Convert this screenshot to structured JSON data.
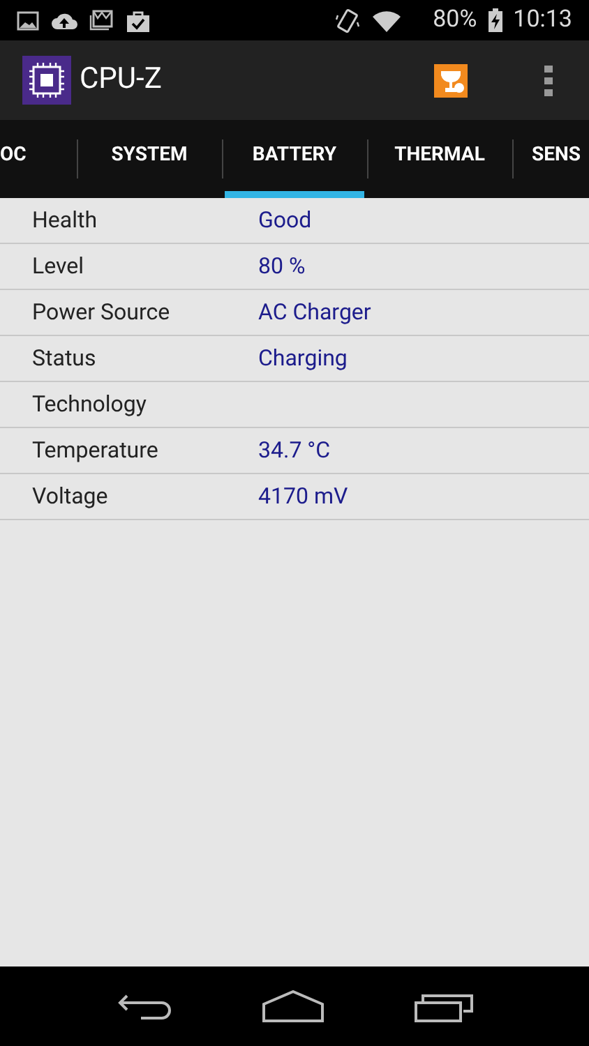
{
  "status_bar": {
    "battery": "80%",
    "time": "10:13"
  },
  "app_bar": {
    "title": "CPU-Z"
  },
  "tabs": [
    {
      "label": "OC",
      "selected": false
    },
    {
      "label": "SYSTEM",
      "selected": false
    },
    {
      "label": "BATTERY",
      "selected": true
    },
    {
      "label": "THERMAL",
      "selected": false
    },
    {
      "label": "SENS",
      "selected": false
    }
  ],
  "rows": [
    {
      "label": "Health",
      "value": "Good"
    },
    {
      "label": "Level",
      "value": "80 %"
    },
    {
      "label": "Power Source",
      "value": "AC Charger"
    },
    {
      "label": "Status",
      "value": "Charging"
    },
    {
      "label": "Technology"
    },
    {
      "label": "Temperature",
      "value": "34.7 °C"
    },
    {
      "label": "Voltage",
      "value": "4170 mV"
    }
  ]
}
